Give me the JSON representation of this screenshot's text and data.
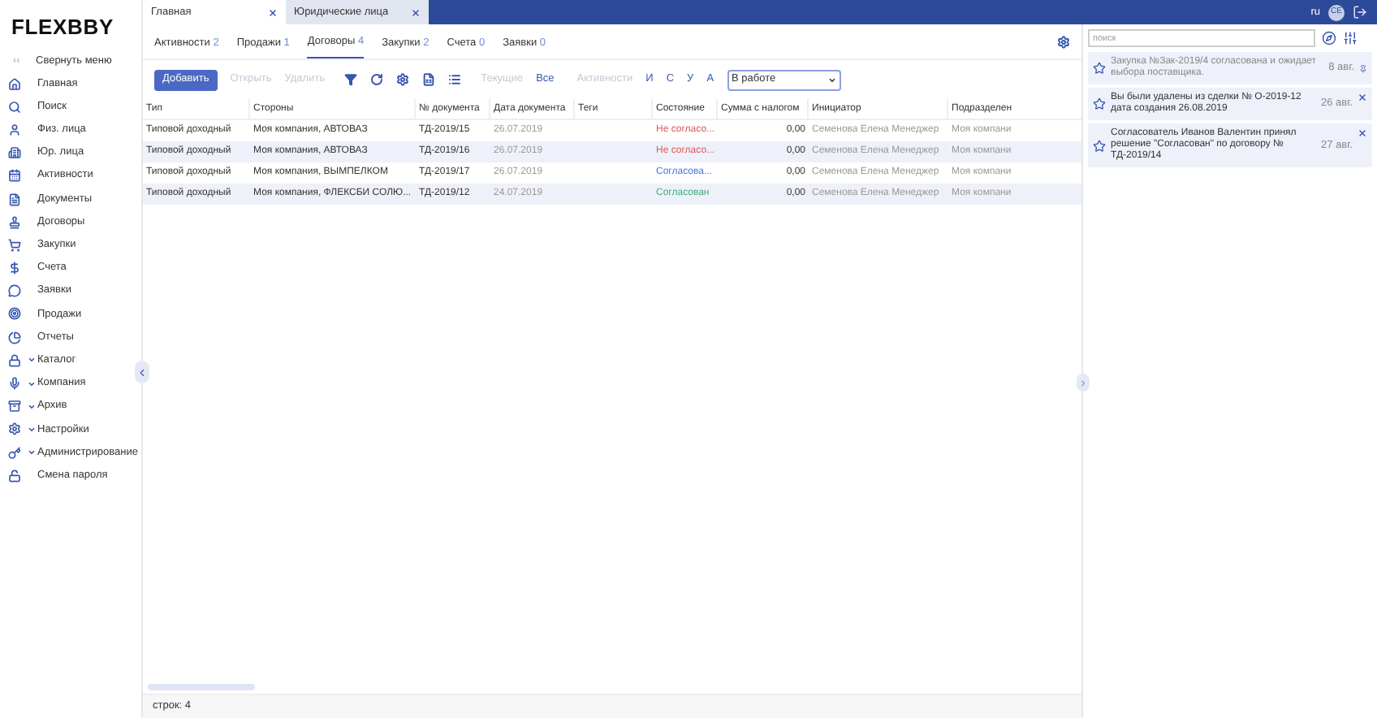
{
  "logo": "FLEXBBY",
  "sidebar": {
    "collapse": {
      "icon": "‹‹",
      "label": "Свернуть меню"
    },
    "items": [
      {
        "label": "Главная",
        "expandable": false
      },
      {
        "label": "Поиск",
        "expandable": false
      },
      {
        "label": "Физ. лица",
        "expandable": false
      },
      {
        "label": "Юр. лица",
        "expandable": false
      },
      {
        "label": "Активности",
        "expandable": false
      },
      {
        "label": "Документы",
        "expandable": false
      },
      {
        "label": "Договоры",
        "expandable": false
      },
      {
        "label": "Закупки",
        "expandable": false
      },
      {
        "label": "Счета",
        "expandable": false
      },
      {
        "label": "Заявки",
        "expandable": false
      },
      {
        "label": "Продажи",
        "expandable": false
      },
      {
        "label": "Отчеты",
        "expandable": false
      },
      {
        "label": "Каталог",
        "expandable": true
      },
      {
        "label": "Компания",
        "expandable": true
      },
      {
        "label": "Архив",
        "expandable": true
      },
      {
        "label": "Настройки",
        "expandable": true
      },
      {
        "label": "Администрирование",
        "expandable": true
      },
      {
        "label": "Смена пароля",
        "expandable": false
      }
    ]
  },
  "tabs": [
    {
      "label": "Главная",
      "selected": true
    },
    {
      "label": "Юридические лица",
      "selected": false
    }
  ],
  "topbar": {
    "lang": "ru",
    "avatar": "СЕ"
  },
  "subtabs": [
    {
      "label": "Активности",
      "count": "2",
      "selected": false
    },
    {
      "label": "Продажи",
      "count": "1",
      "selected": false
    },
    {
      "label": "Договоры",
      "count": "4",
      "selected": true
    },
    {
      "label": "Закупки",
      "count": "2",
      "selected": false
    },
    {
      "label": "Счета",
      "count": "0",
      "selected": false
    },
    {
      "label": "Заявки",
      "count": "0",
      "selected": false
    }
  ],
  "toolbar": {
    "add": "Добавить",
    "open": "Открыть",
    "delete": "Удалить",
    "current": "Текущие",
    "all": "Все",
    "activities": "Активности",
    "letters": [
      "И",
      "С",
      "У",
      "А"
    ],
    "status_select": "В работе"
  },
  "table": {
    "columns": [
      "Тип",
      "Стороны",
      "№ документа",
      "Дата документа",
      "Теги",
      "Состояние",
      "Сумма с налогом",
      "Инициатор",
      "Подразделен"
    ],
    "rows": [
      {
        "type": "Типовой доходный",
        "parties": "Моя компания, АВТОВАЗ",
        "number": "ТД-2019/15",
        "date": "26.07.2019",
        "status": "Не согласо...",
        "color": "#e05555",
        "sum": "0,00",
        "initiator": "Семенова Елена Менеджер",
        "dept": "Моя компани"
      },
      {
        "type": "Типовой доходный",
        "parties": "Моя компания, АВТОВАЗ",
        "number": "ТД-2019/16",
        "date": "26.07.2019",
        "status": "Не согласо...",
        "color": "#e05555",
        "sum": "0,00",
        "initiator": "Семенова Елена Менеджер",
        "dept": "Моя компани"
      },
      {
        "type": "Типовой доходный",
        "parties": "Моя компания, ВЫМПЕЛКОМ",
        "number": "ТД-2019/17",
        "date": "26.07.2019",
        "status": "Согласова...",
        "color": "#4a74e0",
        "sum": "0,00",
        "initiator": "Семенова Елена Менеджер",
        "dept": "Моя компани"
      },
      {
        "type": "Типовой доходный",
        "parties": "Моя компания, ФЛЕКСБИ СОЛЮ...",
        "number": "ТД-2019/12",
        "date": "24.07.2019",
        "status": "Согласован",
        "color": "#3fae7a",
        "sum": "0,00",
        "initiator": "Семенова Елена Менеджер",
        "dept": "Моя компани"
      }
    ]
  },
  "footer": "строк: 4",
  "notifications": {
    "search": {
      "placeholder": "поиск"
    },
    "items": [
      {
        "text": "Закупка №Зак-2019/4 согласована и ожидает выбора поставщика.",
        "date": "8 авг.",
        "read": true,
        "kind": "pin"
      },
      {
        "text": "Вы были удалены из сделки № О-2019-12 дата создания 26.08.2019",
        "date": "26 авг.",
        "read": false,
        "kind": "close"
      },
      {
        "text": "Согласователь Иванов Валентин принял решение \"Согласован\" по договору № ТД-2019/14",
        "date": "27 авг.",
        "read": false,
        "kind": "close"
      }
    ]
  }
}
